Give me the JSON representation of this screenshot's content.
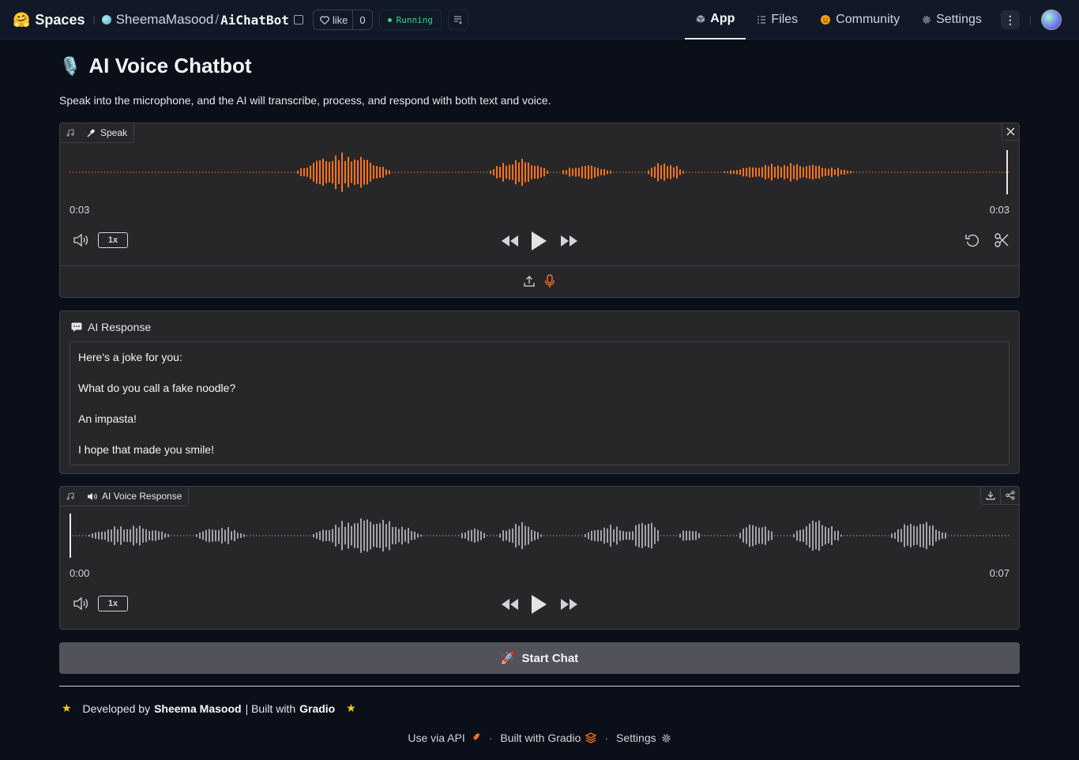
{
  "header": {
    "logo_emoji": "🤗",
    "spaces_label": "Spaces",
    "owner": "SheemaMasood",
    "repo": "AiChatBot",
    "like_label": "like",
    "like_count": "0",
    "status": "Running",
    "nav": [
      {
        "label": "App",
        "icon": "cube-icon",
        "active": true
      },
      {
        "label": "Files",
        "icon": "files-icon",
        "active": false
      },
      {
        "label": "Community",
        "icon": "community-icon",
        "active": false
      },
      {
        "label": "Settings",
        "icon": "gear-icon",
        "active": false
      }
    ]
  },
  "main": {
    "title_emoji": "🎙️",
    "title": "AI Voice Chatbot",
    "description": "Speak into the microphone, and the AI will transcribe, process, and respond with both text and voice.",
    "speak": {
      "label": "Speak",
      "time_current": "0:03",
      "time_total": "0:03",
      "rate": "1x",
      "wave_color": "#f97316"
    },
    "response": {
      "label": "AI Response",
      "lines": [
        "Here's a joke for you:",
        "What do you call a fake noodle?",
        "An impasta!",
        "I hope that made you smile!"
      ]
    },
    "voice": {
      "label": "AI Voice Response",
      "time_current": "0:00",
      "time_total": "0:07",
      "rate": "1x",
      "wave_color": "#a1a1aa"
    },
    "start_button": {
      "emoji": "🚀",
      "label": "Start Chat"
    },
    "credit": {
      "star": "★",
      "prefix": "Developed by",
      "author": "Sheema Masood",
      "mid": "| Built with",
      "tool": "Gradio"
    }
  },
  "footer": {
    "api": "Use via API",
    "built": "Built with Gradio",
    "settings": "Settings"
  }
}
